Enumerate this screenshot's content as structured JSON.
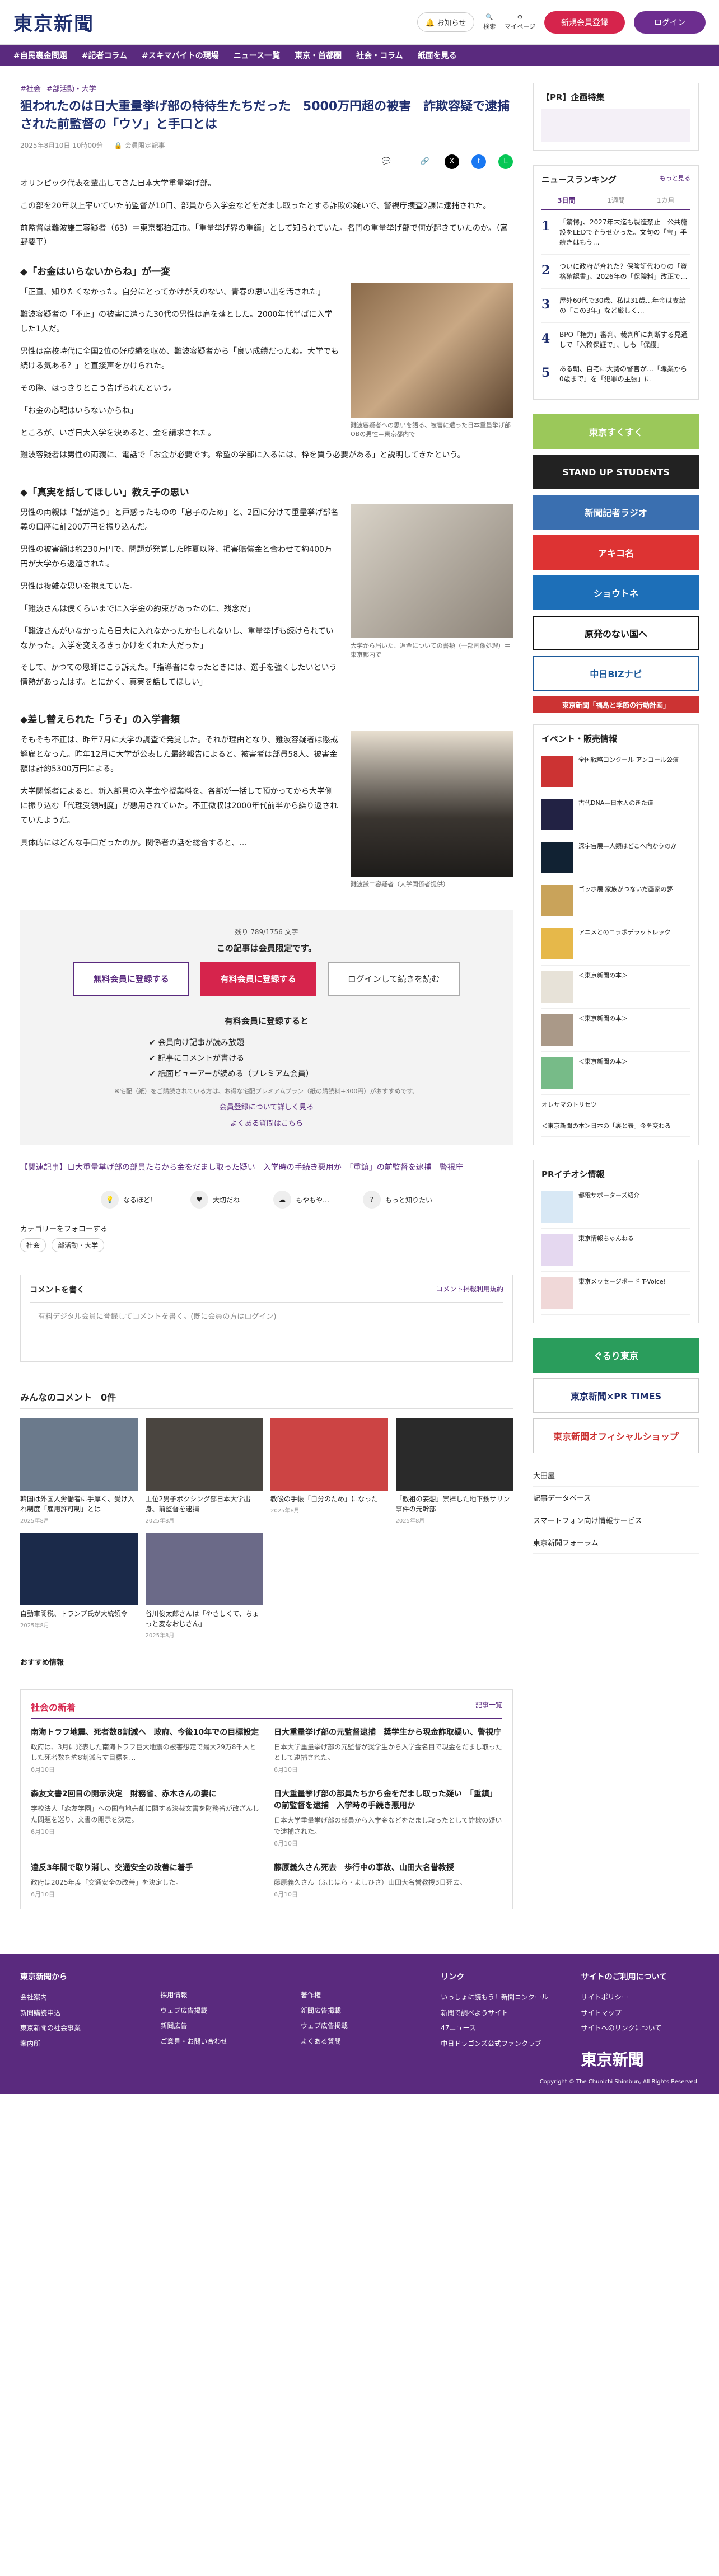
{
  "header": {
    "logo": "東京新聞",
    "notice": "お知らせ",
    "search": "検索",
    "mypage": "マイページ",
    "register": "新規会員登録",
    "login": "ログイン"
  },
  "nav": [
    "#自民裏金問題",
    "#記者コラム",
    "#スキマバイトの現場",
    "ニュース一覧",
    "東京・首都圏",
    "社会・コラム",
    "紙面を見る"
  ],
  "article": {
    "tags": [
      "#社会",
      "#部活動・大学"
    ],
    "title": "狙われたのは日大重量挙げ部の特待生たちだった　5000万円超の被害　詐欺容疑で逮捕された前監督の「ウソ」と手口とは",
    "date": "2025年8月10日 10時00分",
    "member_label": "会員限定記事",
    "comments": "0",
    "lead": "オリンピック代表を輩出してきた日本大学重量挙げ部。",
    "paragraphs1": [
      "この部を20年以上率いていた前監督が10日、部員から入学金などをだまし取ったとする詐欺の疑いで、警視庁捜査2課に逮捕された。",
      "前監督は難波謙二容疑者（63）＝東京都狛江市。「重量挙げ界の重鎮」として知られていた。名門の重量挙げ部で何が起きていたのか。（宮野要平）"
    ],
    "h_a": "◆「お金はいらないからね」が一変",
    "paragraphs2": [
      "「正直、知りたくなかった。自分にとってかけがえのない、青春の思い出を汚された」",
      "難波容疑者の「不正」の被害に遭った30代の男性は肩を落とした。2000年代半ばに入学した1人だ。",
      "男性は高校時代に全国2位の好成績を収め、難波容疑者から「良い成績だったね。大学でも続ける気ある？」と直接声をかけられた。",
      "その際、はっきりとこう告げられたという。",
      "「お金の心配はいらないからね」",
      "ところが、いざ日大入学を決めると、金を請求された。",
      "難波容疑者は男性の両親に、電話で「お金が必要です。希望の学部に入るには、枠を買う必要がある」と説明してきたという。"
    ],
    "fig1_caption": "難波容疑者への思いを語る、被害に遭った日本重量挙げ部OBの男性＝東京都内で",
    "h_b": "◆「真実を話してほしい」教え子の思い",
    "paragraphs3": [
      "男性の両親は「話が違う」と戸惑ったものの「息子のため」と、2回に分けて重量挙げ部名義の口座に計200万円を振り込んだ。",
      "男性の被害額は約230万円で、問題が発覚した昨夏以降、損害賠償金と合わせて約400万円が大学から返還された。",
      "男性は複雑な思いを抱えていた。",
      "「難波さんは僕くらいまでに入学金の約束があったのに、残念だ」",
      "「難波さんがいなかったら日大に入れなかったかもしれないし、重量挙げも続けられていなかった。入学を変えるきっかけをくれた人だった」",
      "そして、かつての恩師にこう訴えた。「指導者になったときには、選手を強くしたいという情熱があったはず。とにかく、真実を話してほしい」"
    ],
    "fig2_caption": "大学から届いた、返金についての書類（一部画像処理）＝東京都内で",
    "h_c": "◆差し替えられた「うそ」の入学書類",
    "paragraphs4": [
      "そもそも不正は、昨年7月に大学の調査で発覚した。それが理由となり、難波容疑者は懲戒解雇となった。昨年12月に大学が公表した最終報告によると、被害者は部員58人、被害金額は計約5300万円による。",
      "大学関係者によると、新入部員の入学金や授業料を、各部が一括して預かってから大学側に振り込む「代理受領制度」が悪用されていた。不正徴収は2000年代前半から繰り返されていたようだ。",
      "具体的にはどんな手口だったのか。関係者の話を総合すると、…"
    ],
    "fig3_caption": "難波謙二容疑者（大学関係者提供）",
    "paywall": {
      "note": "残り 789/1756 文字",
      "title": "この記事は会員限定です。",
      "free": "無料会員に登録する",
      "paid": "有料会員に登録する",
      "login": "ログインして続きを読む",
      "perks_title": "有料会員に登録すると",
      "perks": [
        "会員向け記事が読み放題",
        "記事にコメントが書ける",
        "紙面ビューアーが読める（プレミアム会員）"
      ],
      "small": "※宅配（紙）をご購読されている方は、お得な宅配プレミアムプラン（紙の購読料+300円）がおすすめです。",
      "link1": "会員登録について詳しく見る",
      "link2": "よくある質問はこちら"
    },
    "related": "【関連記事】日大重量挙げ部の部員たちから金をだまし取った疑い　入学時の手続き悪用か　「重鎮」の前監督を逮捕　警視庁",
    "reactions": [
      "なるほど！",
      "大切だね",
      "もやもや…",
      "もっと知りたい"
    ],
    "follow": "カテゴリーをフォローする",
    "chips": [
      "社会",
      "部活動・大学"
    ]
  },
  "comment": {
    "title": "コメントを書く",
    "rule": "コメント掲載利用規約",
    "placeholder": "有料デジタル会員に登録してコメントを書く。(既に会員の方はログイン)"
  },
  "popular": {
    "title": "みんなのコメント　0件",
    "items": [
      {
        "t": "韓国は外国人労働者に手厚く、受け入れ制度「雇用許可制」とは",
        "d": "2025年8月"
      },
      {
        "t": "上位2男子ボクシング部日本大学出身、前監督を逮捕",
        "d": "2025年8月"
      },
      {
        "t": "教唆の手帳「自分のため」になった",
        "d": "2025年8月"
      },
      {
        "t": "「教祖の妄想」崇拝した地下鉄サリン事件の元幹部",
        "d": "2025年8月"
      },
      {
        "t": "自動車関税、トランプ氏が大統領令",
        "d": "2025年8月"
      },
      {
        "t": "谷川俊太郎さんは「やさしくて、ちょっと変なおじさん」",
        "d": "2025年8月"
      }
    ]
  },
  "recommend": "おすすめ情報",
  "social": {
    "title": "社会の新着",
    "more": "記事一覧",
    "items": [
      {
        "h": "南海トラフ地震、死者数8割減へ　政府、今後10年での目標設定",
        "p": "政府は、3月に発表した南海トラフ巨大地震の被害想定で最大29万8千人とした死者数を約8割減らす目標を…",
        "d": "6月10日"
      },
      {
        "h": "日大重量挙げ部の元監督逮捕　奨学生から現金詐取疑い、警視庁",
        "p": "日本大学重量挙げ部の元監督が奨学生から入学金名目で現金をだまし取ったとして逮捕された。",
        "d": "6月10日"
      },
      {
        "h": "森友文書2回目の開示決定　財務省、赤木さんの妻に",
        "p": "学校法人「森友学園」への国有地売却に関する決裁文書を財務省が改ざんした問題を巡り、文書の開示を決定。",
        "d": "6月10日"
      },
      {
        "h": "日大重量挙げ部の部員たちから金をだまし取った疑い　「重鎮」の前監督を逮捕　入学時の手続き悪用か",
        "p": "日本大学重量挙げ部の部員から入学金などをだまし取ったとして詐欺の疑いで逮捕された。",
        "d": "6月10日"
      },
      {
        "h": "違反3年間で取り消し、交通安全の改善に着手",
        "p": "政府は2025年度「交通安全の改善」を決定した。",
        "d": "6月10日"
      },
      {
        "h": "藤原義久さん死去　歩行中の事故、山田大名誉教授",
        "p": "藤原義久さん（ふじはら・よしひさ）山田大名誉教授3日死去。",
        "d": "6月10日"
      }
    ]
  },
  "sidebar": {
    "pr": "【PR】企画特集",
    "ranking_title": "ニュースランキング",
    "ranking_more": "もっと見る",
    "tabs": [
      "3日間",
      "1週間",
      "1カ月"
    ],
    "ranks": [
      "「驚愕」、2027年末迄も製造禁止　公共施設をLEDでそうせかった。文句の「宝」手続きはもう…",
      "ついに政府が斉れた？保険証代わりの「資格確認書」、2026年の「保険料」改正で…",
      "屋外60代で30歳、私は31歳…年金は支給の「この3年」など厳しく…",
      "BPO「権力」審判、裁判所に判断する見通しで「入稿保証で」、しも「保護」",
      "ある朝、自宅に大勢の警官が…「職業から0歳まで」を「犯罪の主張」に"
    ],
    "banners": [
      "東京すくすく",
      "STAND UP STUDENTS",
      "新聞記者ラジオ",
      "アキコ名",
      "ショウトネ",
      "原発のない国へ",
      "中日BiZナビ",
      "東京新聞「福島と季節の行動計画」"
    ],
    "events_title": "イベント・販売情報",
    "events": [
      "全国戦略コンクール アンコール公演",
      "古代DNA—日本人のきた道",
      "深宇宙展—人類はどこへ向かうのか",
      "ゴッホ展 家族がつないだ画家の夢",
      "アニメとのコラボデラットレック",
      "＜東京新聞の本＞",
      "＜東京新聞の本＞",
      "＜東京新聞の本＞"
    ],
    "weekly": "オレサマのトリセツ",
    "weekly2": "＜東京新聞の本＞日本の「裏と表」今を変わる",
    "pr_info": "PRイチオシ情報",
    "pr_items": [
      "都電サポーターズ紹介",
      "東京情報ちゃんねる",
      "東京メッセージボード T-Voice!"
    ],
    "pr_banners": [
      "ぐるり東京",
      "東京新聞×PR TIMES",
      "東京新聞オフィシャルショップ"
    ],
    "menu": [
      "大田屋",
      "記事データベース",
      "スマートフォン向け情報サービス",
      "東京新聞フォーラム"
    ]
  },
  "footer": {
    "col1": "東京新聞から",
    "col1_items": [
      "会社案内",
      "新聞購読申込",
      "東京新聞の社会事業",
      "案内所"
    ],
    "col2_items": [
      "採用情報",
      "ウェブ広告掲載",
      "新聞広告",
      "ご意見・お問い合わせ"
    ],
    "col3_items": [
      "著作権",
      "新聞広告掲載",
      "ウェブ広告掲載",
      "よくある質問"
    ],
    "col4": "リンク",
    "col4_items": [
      "いっしょに読もう！新聞コンクール",
      "新聞で調べようサイト",
      "47ニュース",
      "中日ドラゴンズ公式ファンクラブ"
    ],
    "col5": "サイトのご利用について",
    "col5_items": [
      "サイトポリシー",
      "サイトマップ",
      "サイトへのリンクについて"
    ],
    "copy": "Copyright © The Chunichi Shimbun, All Rights Reserved."
  },
  "colors": {
    "brand": "#5a2a7e",
    "accent": "#d6244c",
    "navy": "#1f2f6e"
  }
}
